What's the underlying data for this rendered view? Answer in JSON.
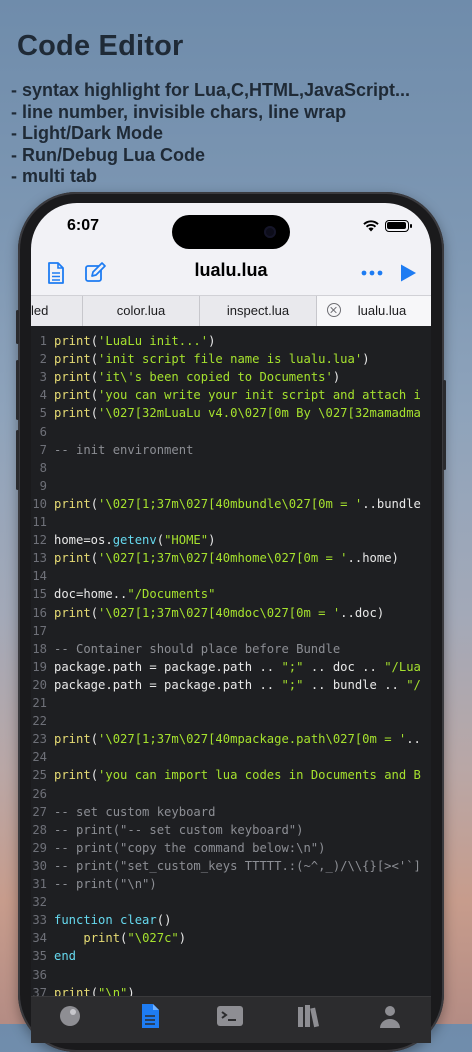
{
  "promo": {
    "title": "Code Editor",
    "features": [
      "- syntax highlight for Lua,C,HTML,JavaScript...",
      "- line number, invisible chars, line wrap",
      "- Light/Dark Mode",
      "- Run/Debug Lua Code",
      "- multi tab"
    ]
  },
  "status_bar": {
    "time": "6:07"
  },
  "navbar": {
    "title": "lualu.lua",
    "icons": [
      "document-icon",
      "edit-icon",
      "more-icon",
      "run-icon"
    ]
  },
  "tabs": [
    {
      "label": "led",
      "active": false
    },
    {
      "label": "color.lua",
      "active": false
    },
    {
      "label": "inspect.lua",
      "active": false
    },
    {
      "label": "lualu.lua",
      "active": true
    }
  ],
  "code_lines": [
    {
      "n": "1",
      "text": "print('LuaLu init...')"
    },
    {
      "n": "2",
      "text": "print('init script file name is lualu.lua')"
    },
    {
      "n": "3",
      "text": "print('it\\'s been copied to Documents')"
    },
    {
      "n": "4",
      "text": "print('you can write your init script and attach i"
    },
    {
      "n": "5",
      "text": "print('\\027[32mLuaLu v4.0\\027[0m By \\027[32mamadma"
    },
    {
      "n": "6",
      "text": ""
    },
    {
      "n": "7",
      "text": "-- init environment"
    },
    {
      "n": "8",
      "text": ""
    },
    {
      "n": "9",
      "text": ""
    },
    {
      "n": "10",
      "text": "print('\\027[1;37m\\027[40mbundle\\027[0m = '..bundle"
    },
    {
      "n": "11",
      "text": ""
    },
    {
      "n": "12",
      "text": "home=os.getenv(\"HOME\")"
    },
    {
      "n": "13",
      "text": "print('\\027[1;37m\\027[40mhome\\027[0m = '..home)"
    },
    {
      "n": "14",
      "text": ""
    },
    {
      "n": "15",
      "text": "doc=home..\"/Documents\""
    },
    {
      "n": "16",
      "text": "print('\\027[1;37m\\027[40mdoc\\027[0m = '..doc)"
    },
    {
      "n": "17",
      "text": ""
    },
    {
      "n": "18",
      "text": "-- Container should place before Bundle"
    },
    {
      "n": "19",
      "text": "package.path = package.path .. \";\" .. doc .. \"/Lua"
    },
    {
      "n": "20",
      "text": "package.path = package.path .. \";\" .. bundle .. \"/"
    },
    {
      "n": "21",
      "text": ""
    },
    {
      "n": "22",
      "text": ""
    },
    {
      "n": "23",
      "text": "print('\\027[1;37m\\027[40mpackage.path\\027[0m = '.."
    },
    {
      "n": "24",
      "text": ""
    },
    {
      "n": "25",
      "text": "print('you can import lua codes in Documents and B"
    },
    {
      "n": "26",
      "text": ""
    },
    {
      "n": "27",
      "text": "-- set custom keyboard"
    },
    {
      "n": "28",
      "text": "-- print(\"-- set custom keyboard\")"
    },
    {
      "n": "29",
      "text": "-- print(\"copy the command below:\\n\")"
    },
    {
      "n": "30",
      "text": "-- print(\"set_custom_keys TTTTT.:(~^,_)/\\\\{}[><'`]"
    },
    {
      "n": "31",
      "text": "-- print(\"\\n\")"
    },
    {
      "n": "32",
      "text": ""
    },
    {
      "n": "33",
      "text": "function clear()"
    },
    {
      "n": "34",
      "text": "    print(\"\\027c\")"
    },
    {
      "n": "35",
      "text": "end"
    },
    {
      "n": "36",
      "text": ""
    },
    {
      "n": "37",
      "text": "print(\"\\n\")"
    }
  ],
  "tab_bar": [
    "circle-icon",
    "document-icon",
    "terminal-icon",
    "library-icon",
    "person-icon"
  ],
  "colors": {
    "accent": "#1e7cf2",
    "editor_bg": "#1e1f22",
    "string": "#a6e22e",
    "function": "#e6db74",
    "comment": "#8c8e94",
    "keyword": "#66d9ef"
  }
}
